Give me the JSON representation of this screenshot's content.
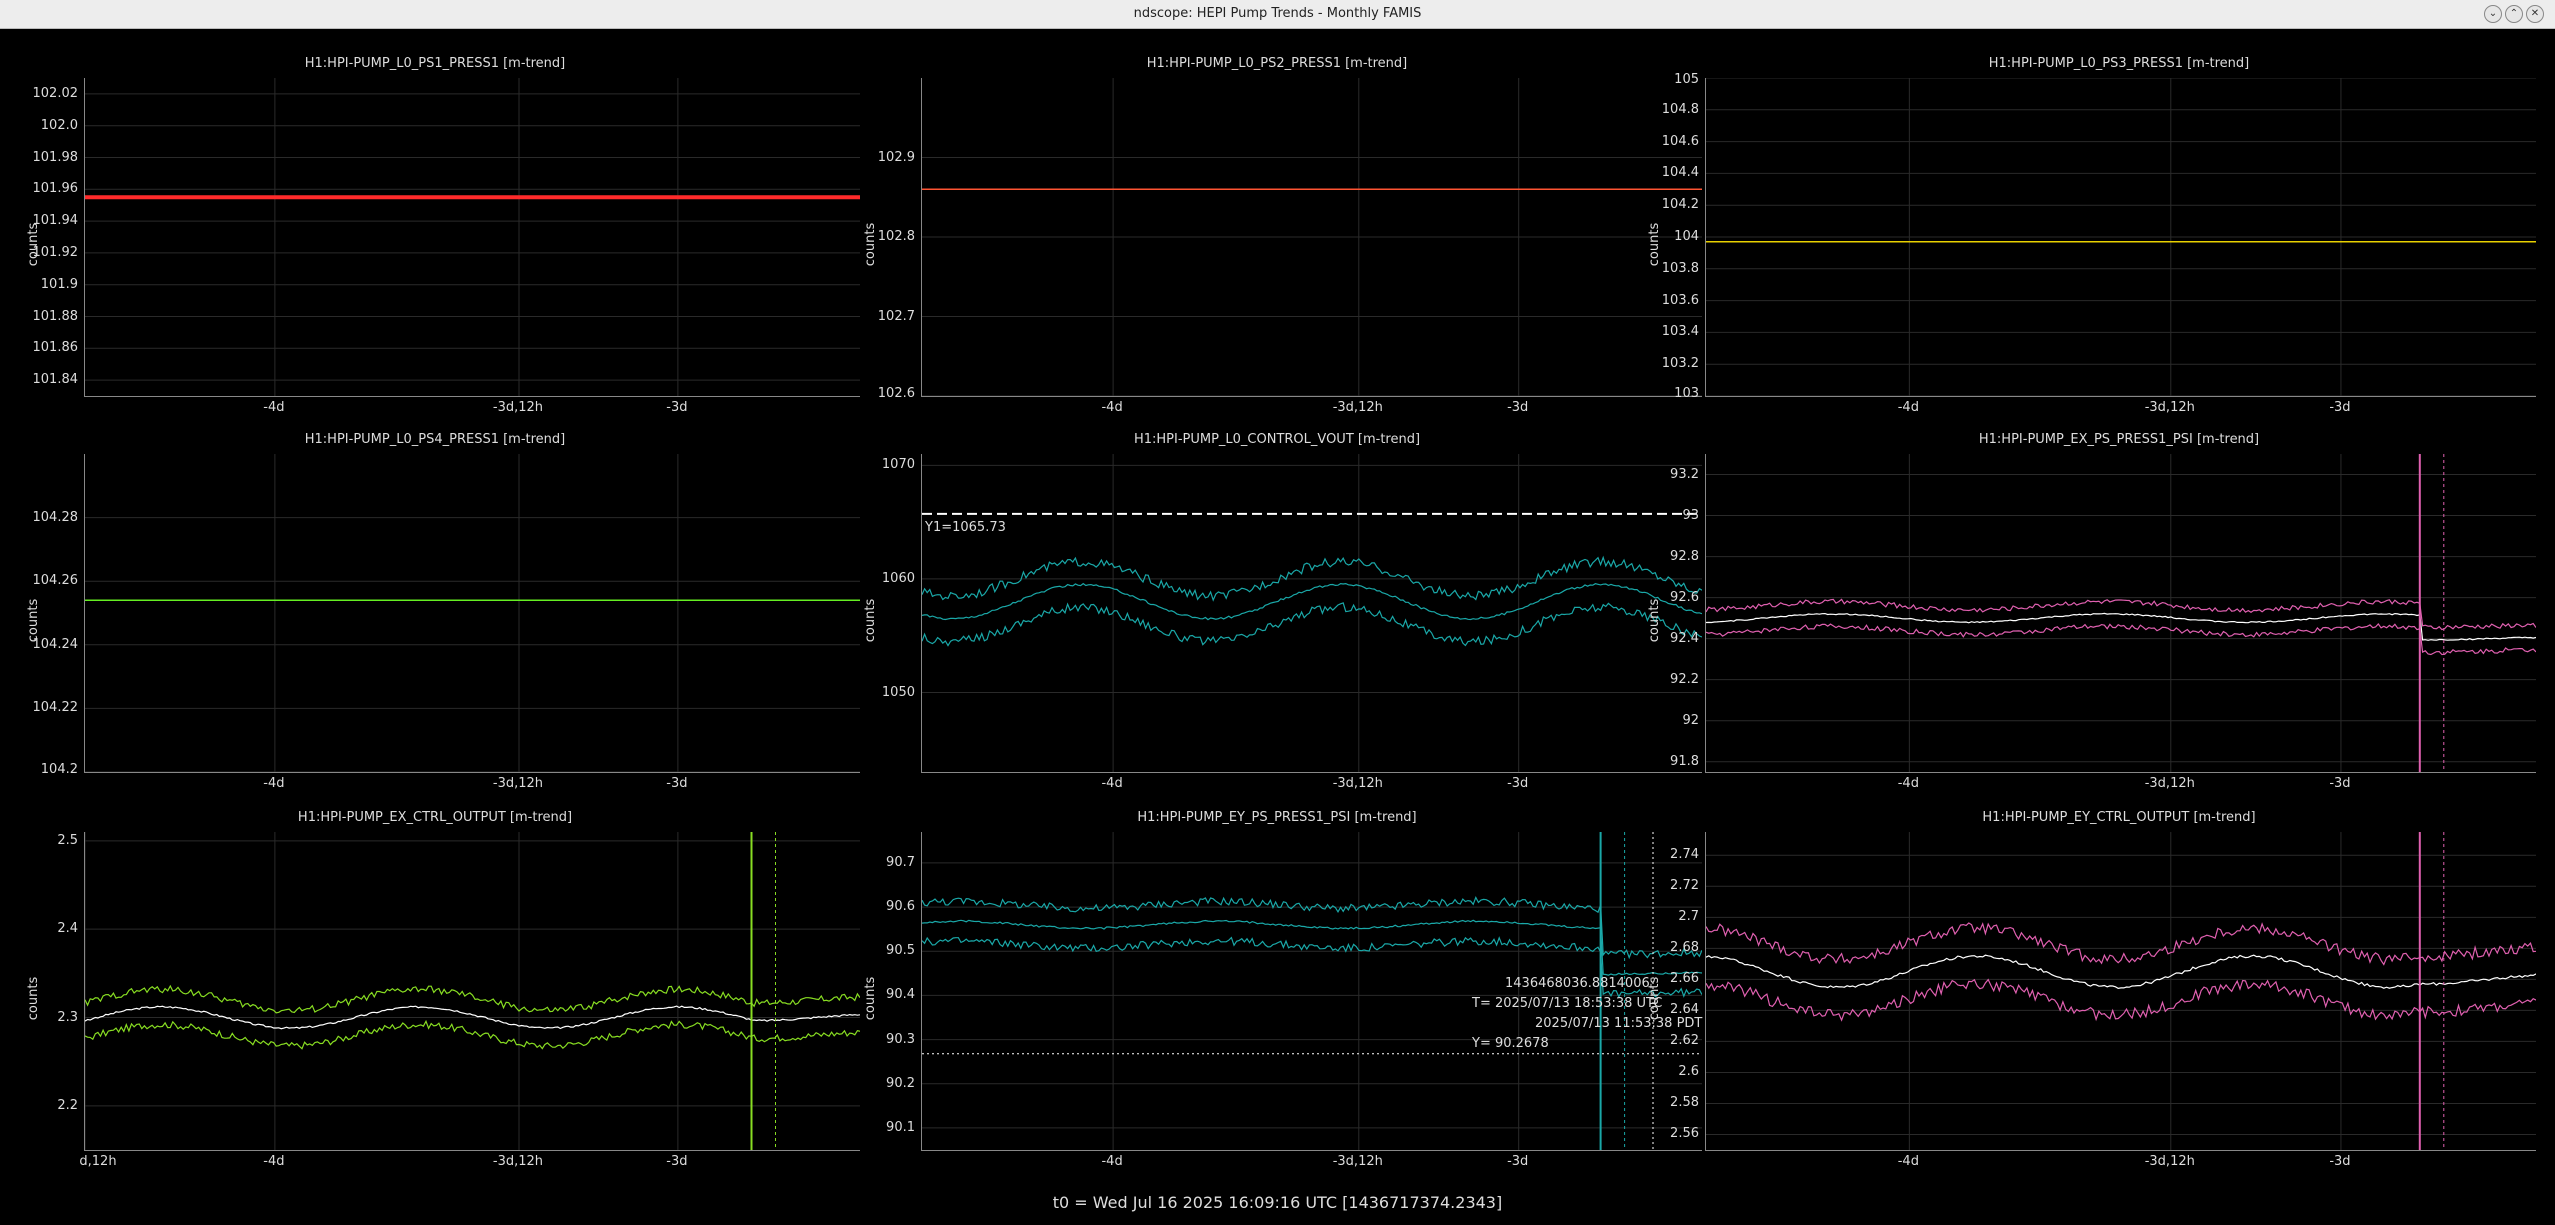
{
  "window": {
    "title": "ndscope: HEPI Pump Trends - Monthly FAMIS"
  },
  "footer": {
    "t0": "t0 = Wed Jul 16 2025 16:09:16 UTC [1436717374.2343]"
  },
  "ylabel": "counts",
  "panels": [
    {
      "title": "H1:HPI-PUMP_L0_PS1_PRESS1 [m-trend]",
      "yticks": [
        "102.02",
        "102.0",
        "101.98",
        "101.96",
        "101.94",
        "101.92",
        "101.9",
        "101.88",
        "101.86",
        "101.84"
      ],
      "xticks": [
        "-4d",
        "-3d,12h",
        "-3d"
      ],
      "color": "#ff2a2a",
      "kind": "flat",
      "ylim": [
        101.83,
        102.03
      ],
      "level": 101.955
    },
    {
      "title": "H1:HPI-PUMP_L0_PS2_PRESS1 [m-trend]",
      "yticks": [
        "102.9",
        "102.8",
        "102.7",
        "102.6"
      ],
      "xticks": [
        "-4d",
        "-3d,12h",
        "-3d"
      ],
      "color": "#ff5533",
      "kind": "flat",
      "ylim": [
        102.6,
        103.0
      ],
      "level": 102.86
    },
    {
      "title": "H1:HPI-PUMP_L0_PS3_PRESS1 [m-trend]",
      "yticks": [
        "105",
        "104.8",
        "104.6",
        "104.4",
        "104.2",
        "104",
        "103.8",
        "103.6",
        "103.4",
        "103.2",
        "103"
      ],
      "xticks": [
        "-4d",
        "-3d,12h",
        "-3d"
      ],
      "color": "#e8d000",
      "kind": "flat",
      "ylim": [
        103.0,
        105.0
      ],
      "level": 103.97
    },
    {
      "title": "H1:HPI-PUMP_L0_PS4_PRESS1 [m-trend]",
      "yticks": [
        "104.28",
        "104.26",
        "104.24",
        "104.22",
        "104.2"
      ],
      "xticks": [
        "-4d",
        "-3d,12h",
        "-3d"
      ],
      "color": "#66ee22",
      "kind": "flat",
      "ylim": [
        104.2,
        104.3
      ],
      "level": 104.254
    },
    {
      "title": "H1:HPI-PUMP_L0_CONTROL_VOUT [m-trend]",
      "yticks": [
        "1070",
        "1060",
        "1050"
      ],
      "xticks": [
        "-4d",
        "-3d,12h",
        "-3d"
      ],
      "color": "#1aa8a8",
      "kind": "band",
      "ylim": [
        1043,
        1071
      ],
      "center": 1058,
      "amp": 1.5,
      "spread": 2.0,
      "cursor": {
        "y": 1065.73,
        "label": "Y1=1065.73"
      }
    },
    {
      "title": "H1:HPI-PUMP_EX_PS_PRESS1_PSI [m-trend]",
      "yticks": [
        "93.2",
        "93",
        "92.8",
        "92.6",
        "92.4",
        "92.2",
        "92",
        "91.8"
      ],
      "xticks": [
        "-4d",
        "-3d,12h",
        "-3d"
      ],
      "color": "#e060b0",
      "kind": "band",
      "ylim": [
        91.75,
        93.3
      ],
      "center": 92.5,
      "amp": 0.02,
      "spread": 0.06,
      "step": {
        "at": 0.86,
        "to": 92.4
      }
    },
    {
      "title": "H1:HPI-PUMP_EX_CTRL_OUTPUT [m-trend]",
      "yticks": [
        "2.5",
        "2.4",
        "2.3",
        "2.2"
      ],
      "xticks": [
        "d,12h",
        "-4d",
        "-3d,12h",
        "-3d"
      ],
      "color": "#88dd22",
      "kind": "band",
      "ylim": [
        2.15,
        2.51
      ],
      "center": 2.3,
      "amp": 0.012,
      "spread": 0.02,
      "step": {
        "at": 0.86,
        "to": 2.3
      }
    },
    {
      "title": "H1:HPI-PUMP_EY_PS_PRESS1_PSI [m-trend]",
      "yticks": [
        "90.7",
        "90.6",
        "90.5",
        "90.4",
        "90.3",
        "90.2",
        "90.1"
      ],
      "xticks": [
        "-4d",
        "-3d,12h",
        "-3d"
      ],
      "color": "#1aa8a8",
      "kind": "band",
      "ylim": [
        90.05,
        90.77
      ],
      "center": 90.56,
      "amp": 0.008,
      "spread": 0.045,
      "step": {
        "at": 0.87,
        "to": 90.45
      },
      "cursor": {
        "y": 90.2678,
        "label": "Y= 90.2678",
        "gps": "1436468036.8814006",
        "utc": "T= 2025/07/13 18:53:38 UTC",
        "pdt": "2025/07/13 11:53:38 PDT"
      }
    },
    {
      "title": "H1:HPI-PUMP_EY_CTRL_OUTPUT [m-trend]",
      "yticks": [
        "2.74",
        "2.72",
        "2.7",
        "2.68",
        "2.66",
        "2.64",
        "2.62",
        "2.6",
        "2.58",
        "2.56"
      ],
      "xticks": [
        "-4d",
        "-3d,12h",
        "-3d"
      ],
      "color": "#e060b0",
      "kind": "band",
      "ylim": [
        2.55,
        2.755
      ],
      "center": 2.665,
      "amp": 0.01,
      "spread": 0.018,
      "step": {
        "at": 0.86,
        "to": 2.66
      }
    }
  ]
}
